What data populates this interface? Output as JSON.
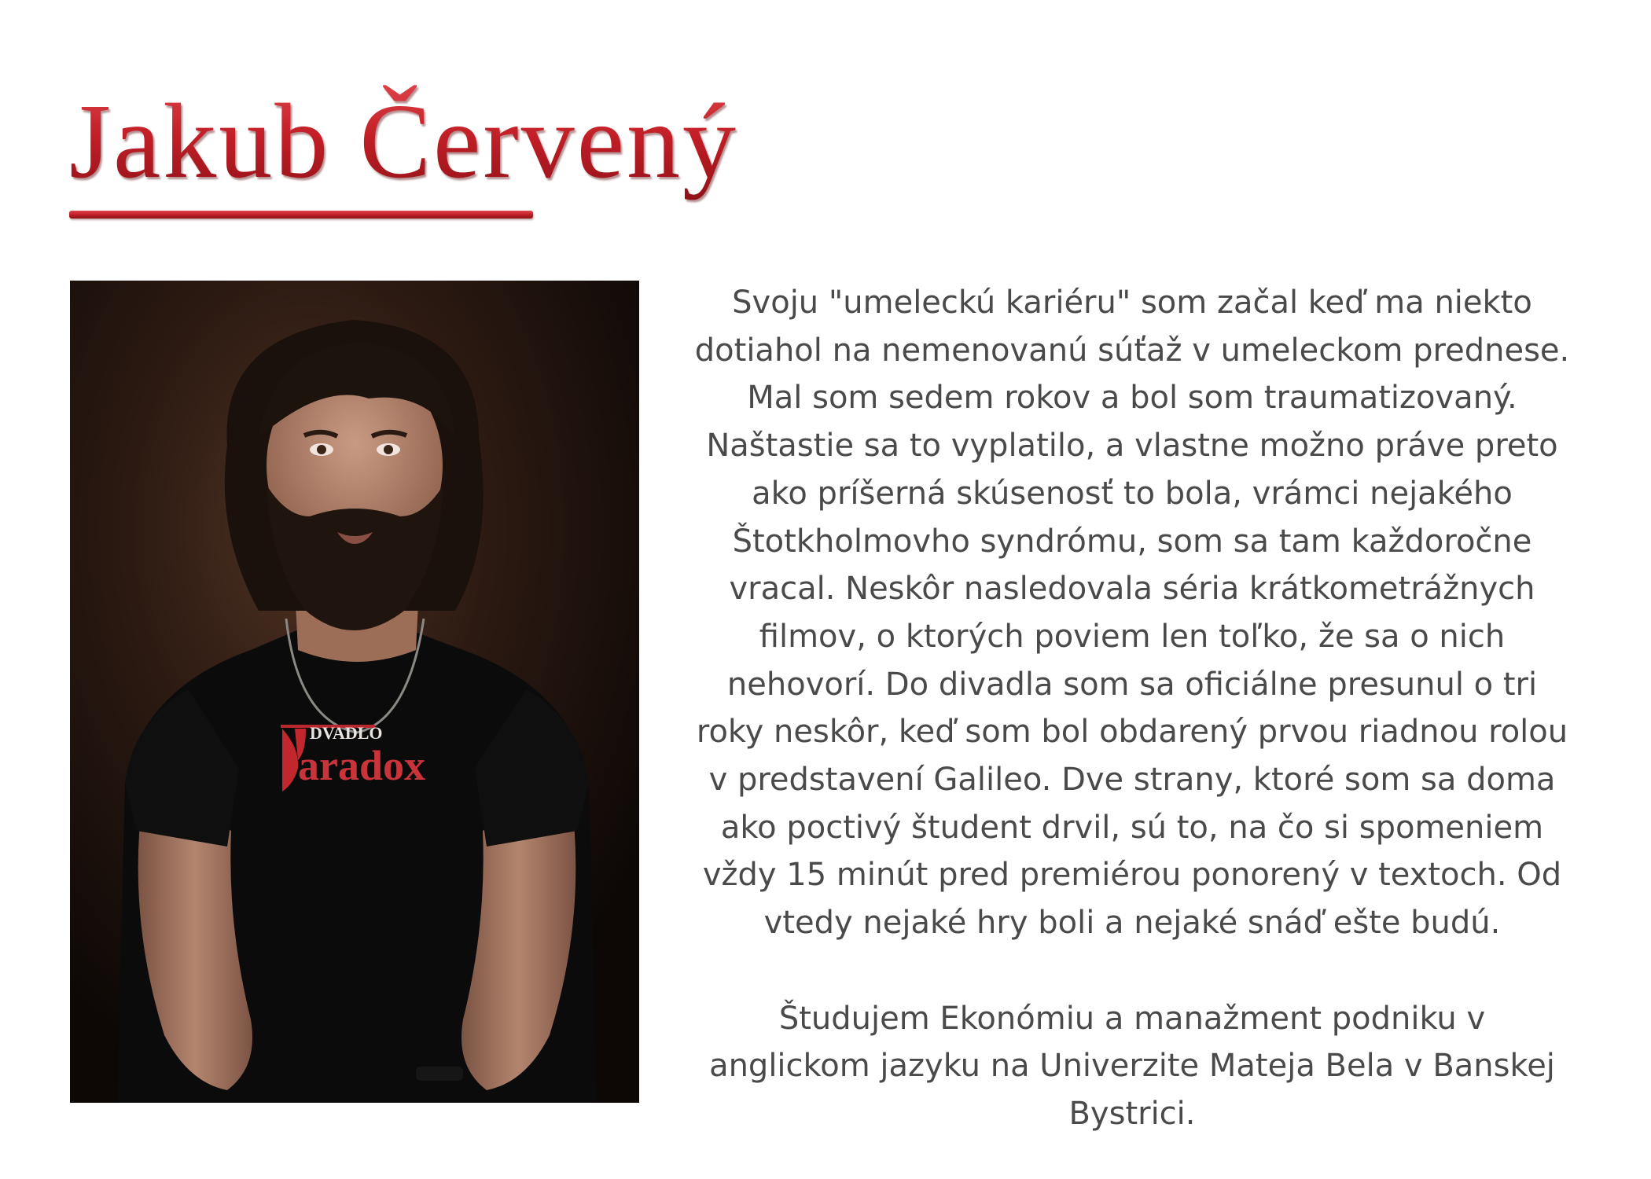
{
  "title": "Jakub Červený",
  "colors": {
    "title_red": "#c4232b",
    "body_text": "#4a4a4a",
    "photo_background": "#2e1c14"
  },
  "portrait": {
    "shirt_print_small": "DVADLO",
    "shirt_print_large": "aradox"
  },
  "bio": {
    "paragraph_1": [
      "Svoju \"umeleckú kariéru\" som začal keď ma niekto",
      "dotiahol na nemenovanú súťaž v umeleckom prednese.",
      "Mal som sedem rokov a bol som traumatizovaný.",
      "Naštastie sa to vyplatilo, a vlastne možno práve preto",
      "ako príšerná skúsenosť to bola, vrámci nejakého",
      "Štotkholmovho syndrómu, som sa tam každoročne",
      "vracal. Neskôr nasledovala séria krátkometrážnych",
      "filmov, o ktorých poviem len toľko, že sa o nich",
      "nehovorí. Do divadla som sa oficiálne presunul o tri",
      "roky neskôr, keď som bol obdarený prvou riadnou rolou",
      "v predstavení Galileo. Dve strany, ktoré som sa doma",
      "ako poctivý študent drvil, sú to, na čo si spomeniem",
      "vždy 15 minút pred premiérou ponorený v textoch. Od",
      "vtedy nejaké hry boli a nejaké snáď ešte budú."
    ],
    "paragraph_2": [
      "Študujem Ekonómiu a manažment podniku v",
      "anglickom jazyku na Univerzite Mateja Bela v Banskej",
      "Bystrici."
    ]
  }
}
